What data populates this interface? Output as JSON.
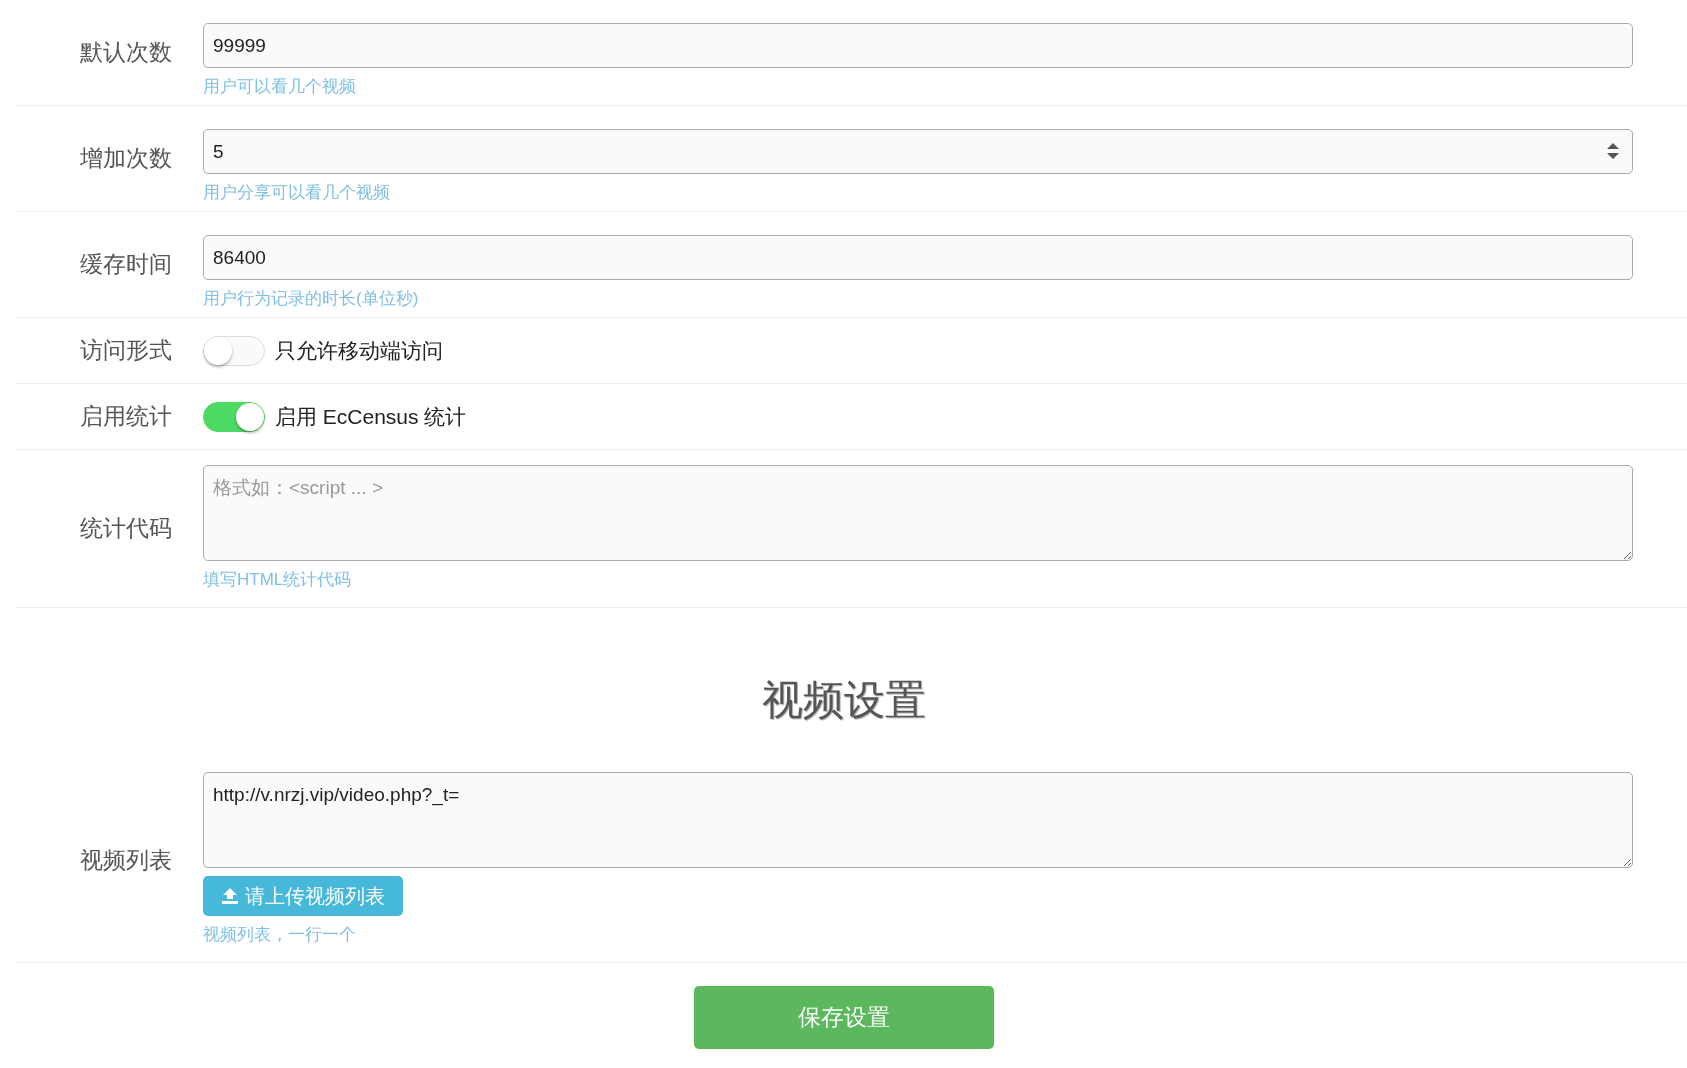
{
  "settings": [
    {
      "kind": "text",
      "label": "默认次数",
      "value": "99999",
      "hint": "用户可以看几个视频"
    },
    {
      "kind": "number",
      "label": "增加次数",
      "value": "5",
      "hint": "用户分享可以看几个视频"
    },
    {
      "kind": "text",
      "label": "缓存时间",
      "value": "86400",
      "hint": "用户行为记录的时长(单位秒)"
    },
    {
      "kind": "switch",
      "label": "访问形式",
      "on": false,
      "caption": "只允许移动端访问"
    },
    {
      "kind": "switch",
      "label": "启用统计",
      "on": true,
      "caption": "启用 EcCensus 统计"
    },
    {
      "kind": "textarea",
      "label": "统计代码",
      "placeholder": "格式如：<script ... >",
      "hint": "填写HTML统计代码"
    }
  ],
  "video_section": {
    "heading": "视频设置",
    "label": "视频列表",
    "value": "http://v.nrzj.vip/video.php?_t=",
    "upload_button": "请上传视频列表",
    "hint": "视频列表，一行一个"
  },
  "save_button": "保存设置"
}
